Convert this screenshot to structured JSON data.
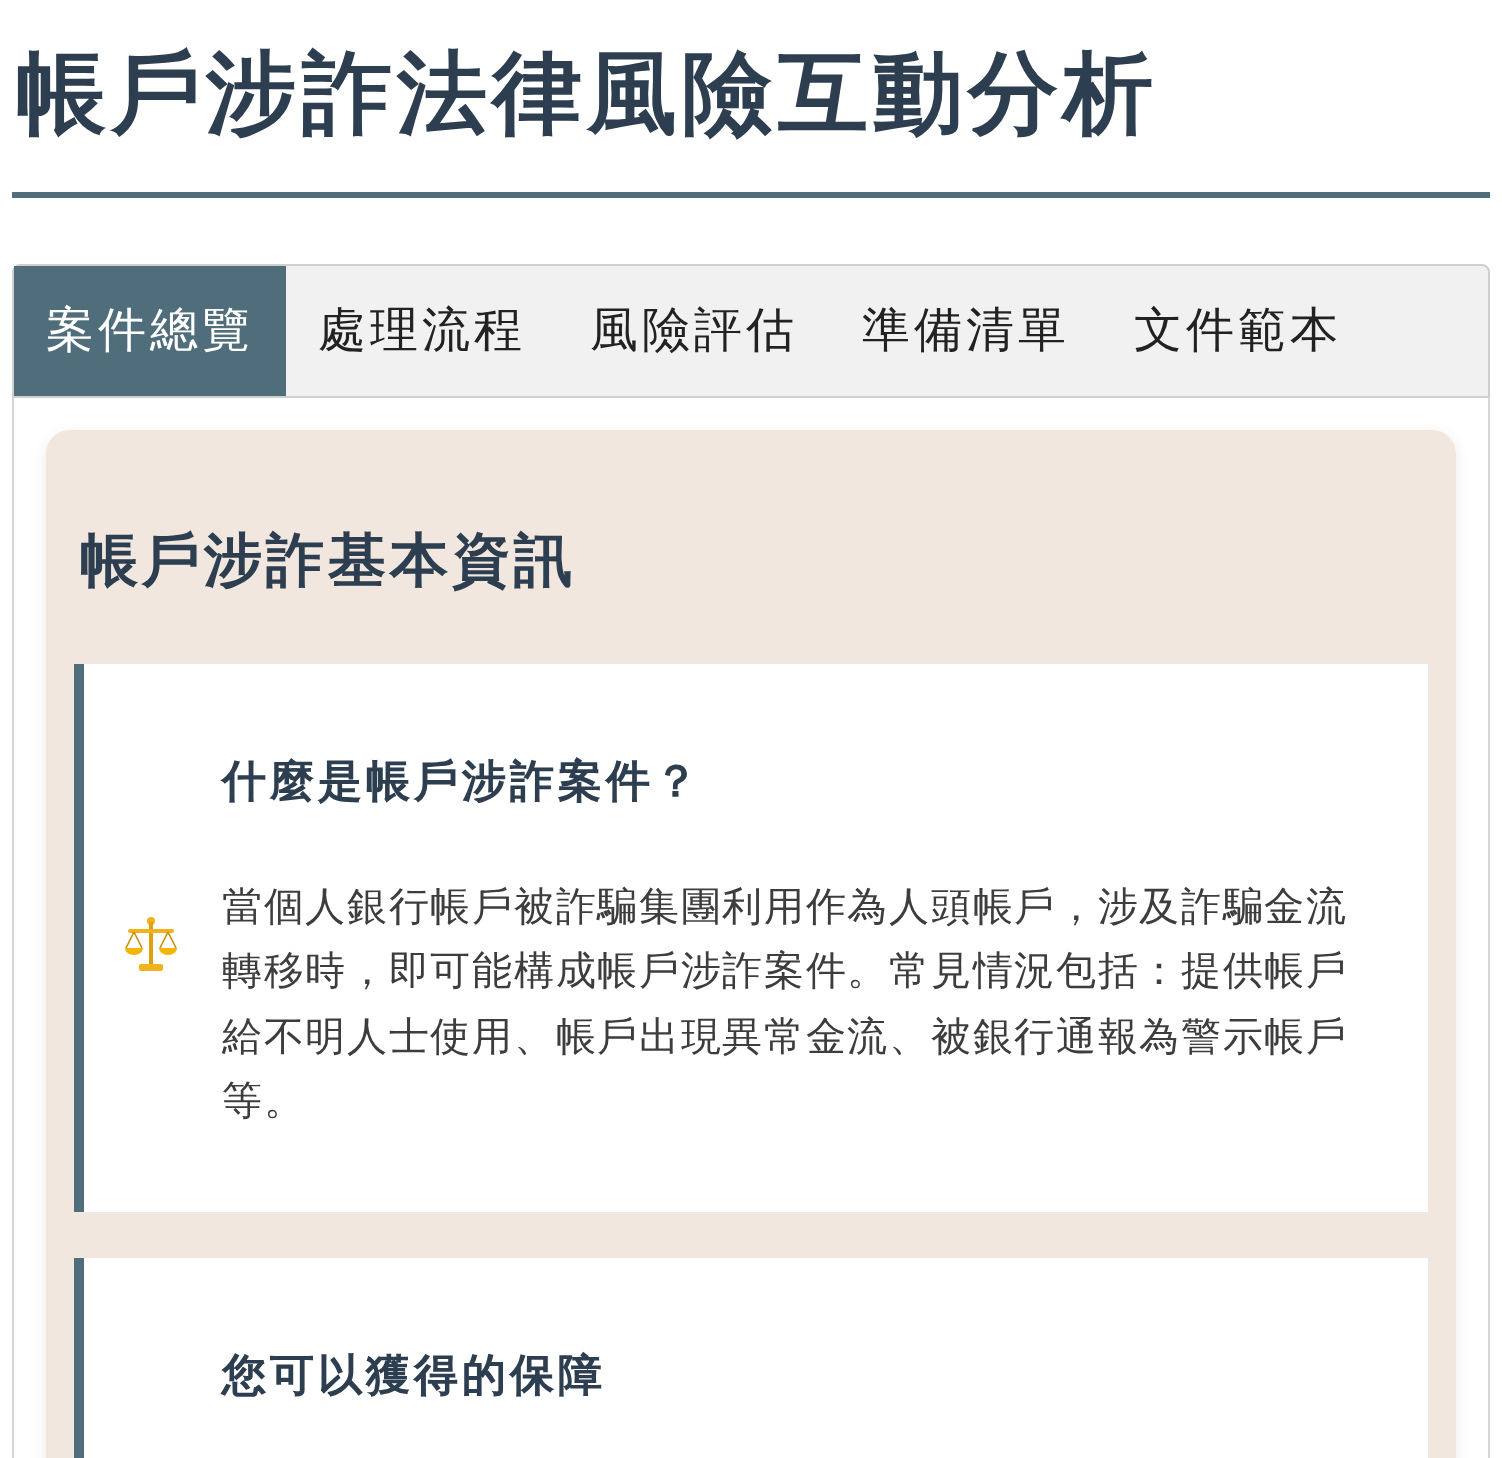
{
  "page_title": "帳戶涉詐法律風險互動分析",
  "tabs": [
    {
      "label": "案件總覽",
      "selected": true
    },
    {
      "label": "處理流程",
      "selected": false
    },
    {
      "label": "風險評估",
      "selected": false
    },
    {
      "label": "準備清單",
      "selected": false
    },
    {
      "label": "文件範本",
      "selected": false
    }
  ],
  "section": {
    "title": "帳戶涉詐基本資訊",
    "cards": [
      {
        "title": "什麼是帳戶涉詐案件？",
        "text": "當個人銀行帳戶被詐騙集團利用作為人頭帳戶，涉及詐騙金流轉移時，即可能構成帳戶涉詐案件。常見情況包括：提供帳戶給不明人士使用、帳戶出現異常金流、被銀行通報為警示帳戶等。"
      },
      {
        "title": "您可以獲得的保障"
      }
    ]
  }
}
